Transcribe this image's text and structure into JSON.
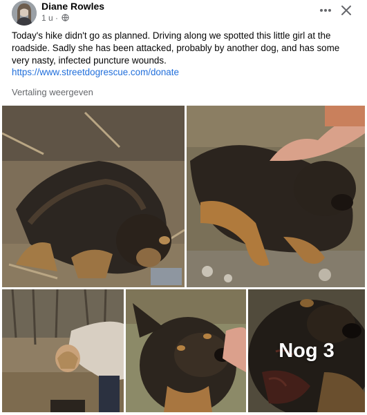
{
  "post": {
    "author": "Diane Rowles",
    "time": "1 u",
    "separator": "·",
    "text": "Today's hike didn't go as planned. Driving along we spotted this little girl at the roadside. Sadly she has been attacked, probably by another dog, and has some very nasty, infected puncture wounds.",
    "link": "https://www.streetdogrescue.com/donate",
    "translate_label": "Vertaling weergeven",
    "more_photos_label": "Nog 3"
  },
  "icons": {
    "privacy": "globe-icon",
    "menu": "more-horizontal-icon",
    "close": "close-icon"
  },
  "colors": {
    "link": "#216fdb",
    "secondary_text": "#65676b",
    "primary_text": "#050505",
    "background": "#e4e6eb"
  }
}
